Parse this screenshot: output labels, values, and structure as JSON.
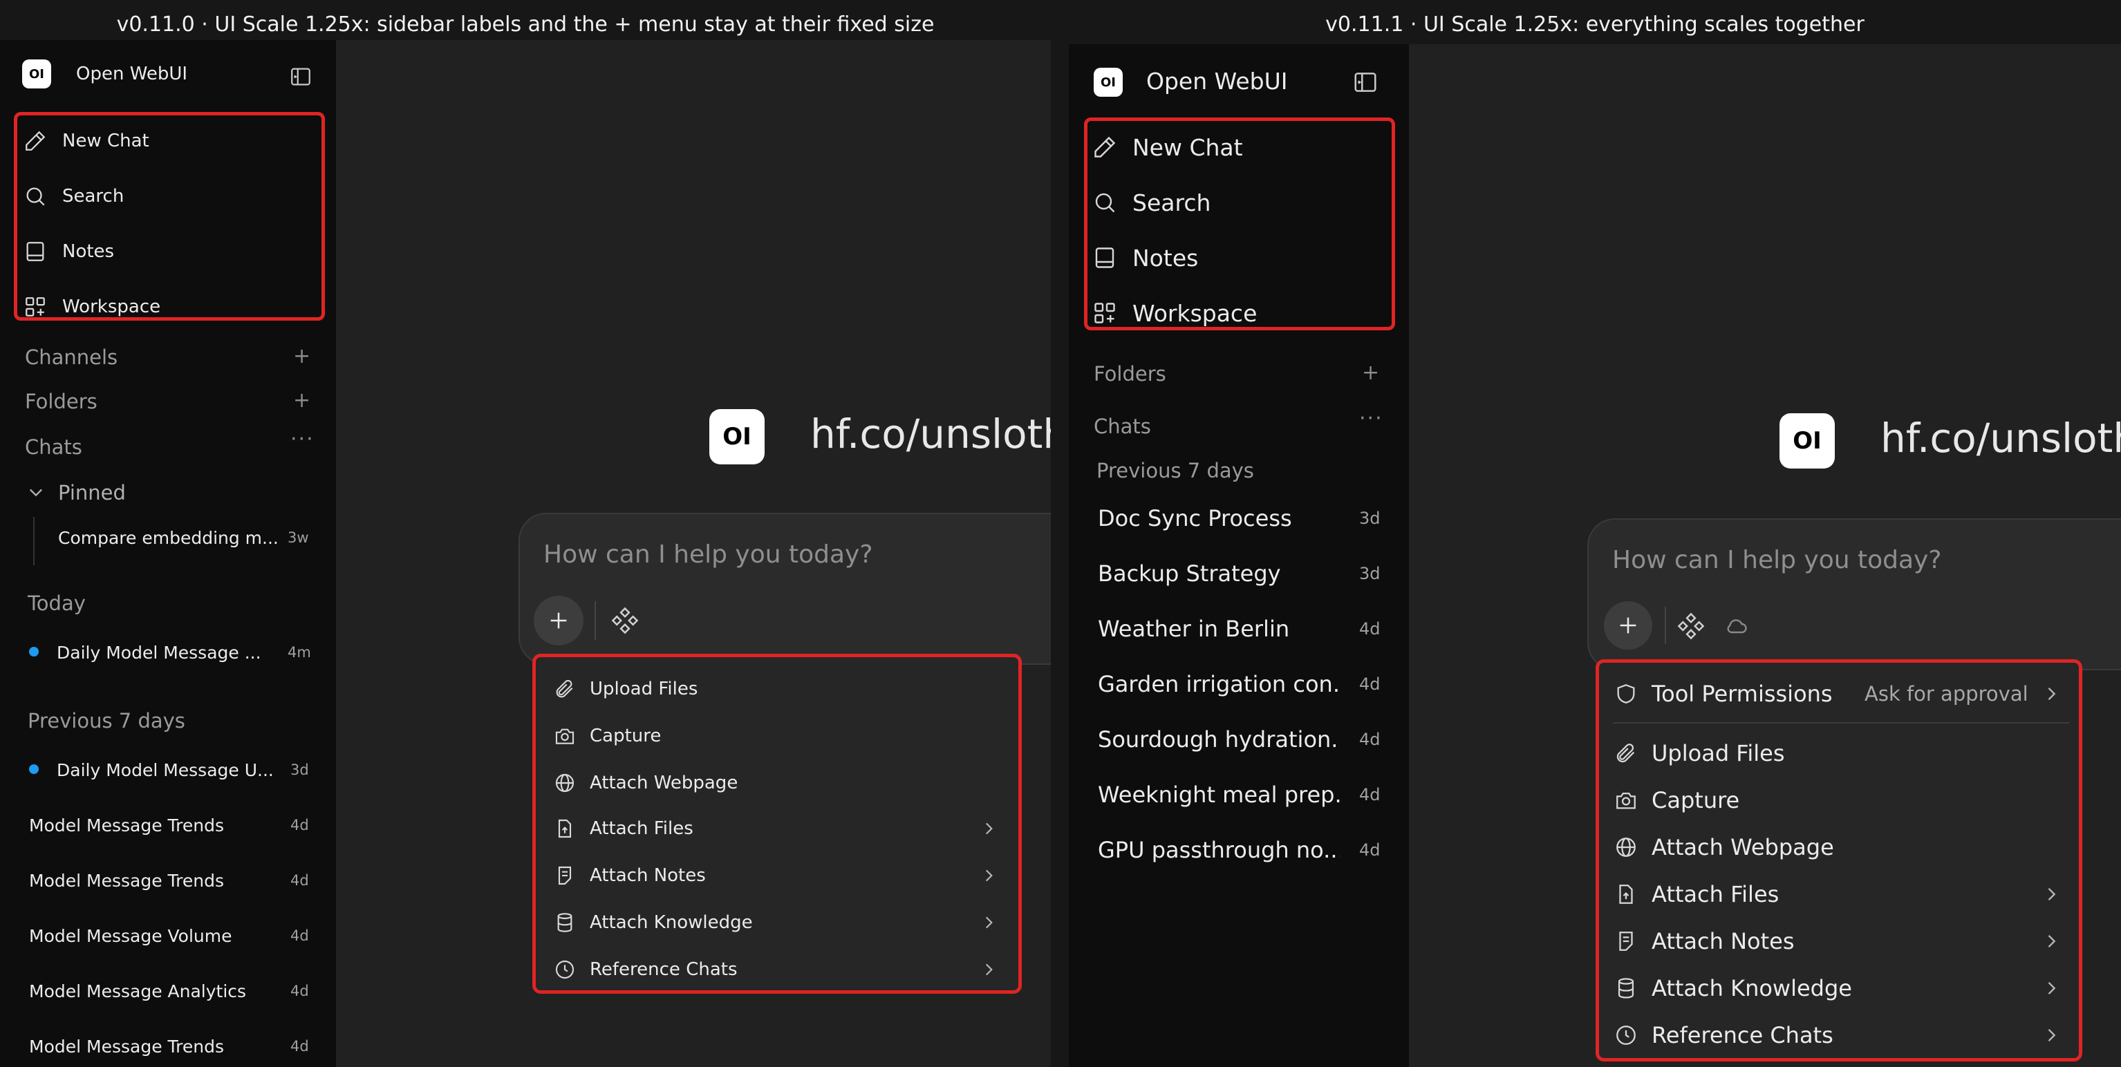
{
  "left": {
    "caption": "v0.11.0 · UI Scale 1.25x: sidebar labels and the + menu stay at their fixed size",
    "app_title": "Open WebUI",
    "logo_text": "OI",
    "nav": [
      "New Chat",
      "Search",
      "Notes",
      "Workspace"
    ],
    "sections": {
      "channels": "Channels",
      "folders": "Folders",
      "chats": "Chats"
    },
    "pinned_label": "Pinned",
    "pinned_chat": {
      "title": "Compare embedding m...",
      "age": "3w"
    },
    "today_label": "Today",
    "today_chat": {
      "title": "Daily Model Message ...",
      "age": "4m"
    },
    "previous_label": "Previous 7 days",
    "previous_chats": [
      {
        "title": "Daily Model Message U...",
        "age": "3d"
      },
      {
        "title": "Model Message Trends",
        "age": "4d"
      },
      {
        "title": "Model Message Trends",
        "age": "4d"
      },
      {
        "title": "Model Message Volume",
        "age": "4d"
      },
      {
        "title": "Model Message Analytics",
        "age": "4d"
      },
      {
        "title": "Model Message Trends",
        "age": "4d"
      }
    ],
    "model_name": "hf.co/unsloth",
    "placeholder": "How can I help you today?",
    "menu": [
      {
        "label": "Upload Files",
        "icon": "paperclip-icon",
        "submenu": false
      },
      {
        "label": "Capture",
        "icon": "camera-icon",
        "submenu": false
      },
      {
        "label": "Attach Webpage",
        "icon": "globe-icon",
        "submenu": false
      },
      {
        "label": "Attach Files",
        "icon": "file-upload-icon",
        "submenu": true
      },
      {
        "label": "Attach Notes",
        "icon": "note-icon",
        "submenu": true
      },
      {
        "label": "Attach Knowledge",
        "icon": "database-icon",
        "submenu": true
      },
      {
        "label": "Reference Chats",
        "icon": "clock-icon",
        "submenu": true
      }
    ]
  },
  "right": {
    "caption": "v0.11.1 · UI Scale 1.25x: everything scales together",
    "app_title": "Open WebUI",
    "logo_text": "OI",
    "nav": [
      "New Chat",
      "Search",
      "Notes",
      "Workspace"
    ],
    "sections": {
      "folders": "Folders",
      "chats": "Chats"
    },
    "previous_label": "Previous 7 days",
    "previous_chats": [
      {
        "title": "Doc Sync Process",
        "age": "3d"
      },
      {
        "title": "Backup Strategy",
        "age": "3d"
      },
      {
        "title": "Weather in Berlin",
        "age": "4d"
      },
      {
        "title": "Garden irrigation con...",
        "age": "4d"
      },
      {
        "title": "Sourdough hydration...",
        "age": "4d"
      },
      {
        "title": "Weeknight meal prep...",
        "age": "4d"
      },
      {
        "title": "GPU passthrough no...",
        "age": "4d"
      }
    ],
    "model_name": "hf.co/unsloth",
    "placeholder": "How can I help you today?",
    "tool_permissions": {
      "label": "Tool Permissions",
      "value": "Ask for approval"
    },
    "menu": [
      {
        "label": "Upload Files",
        "icon": "paperclip-icon",
        "submenu": false
      },
      {
        "label": "Capture",
        "icon": "camera-icon",
        "submenu": false
      },
      {
        "label": "Attach Webpage",
        "icon": "globe-icon",
        "submenu": false
      },
      {
        "label": "Attach Files",
        "icon": "file-upload-icon",
        "submenu": true
      },
      {
        "label": "Attach Notes",
        "icon": "note-icon",
        "submenu": true
      },
      {
        "label": "Attach Knowledge",
        "icon": "database-icon",
        "submenu": true
      },
      {
        "label": "Reference Chats",
        "icon": "clock-icon",
        "submenu": true
      }
    ]
  },
  "colors": {
    "highlight": "#e02424",
    "unread_dot": "#1d9bf0",
    "sidebar_bg": "#0d0d0d",
    "main_bg": "#212121",
    "menu_bg": "#262626"
  }
}
